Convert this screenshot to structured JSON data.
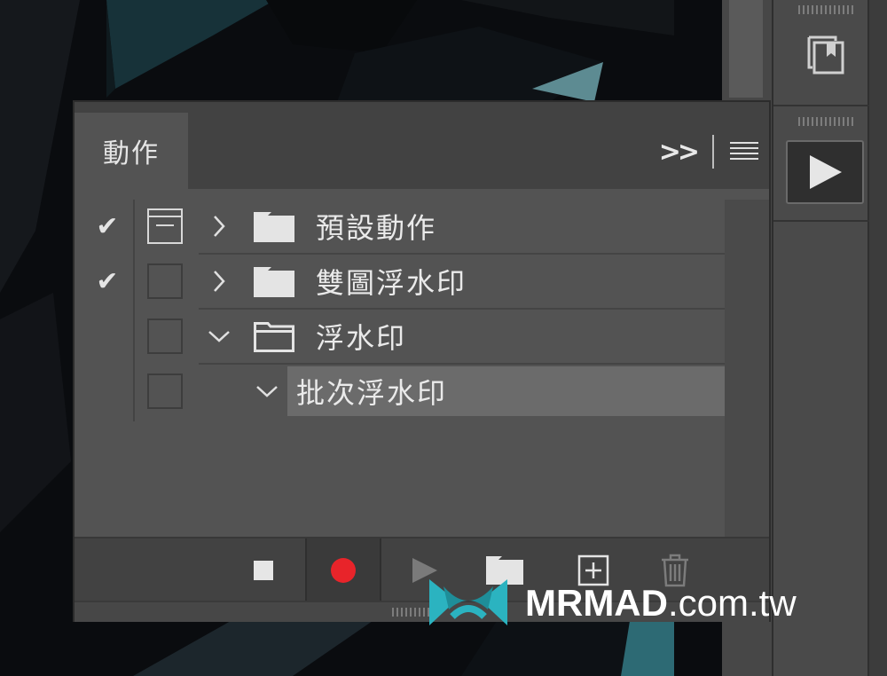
{
  "panel": {
    "tab_label": "動作",
    "menu_icon": "hamburger-icon",
    "expand_icon": "double-chevron-right-icon"
  },
  "actions": [
    {
      "name": "預設動作",
      "included": true,
      "dialog_toggle": "on",
      "expanded": false,
      "type": "set",
      "selected": false
    },
    {
      "name": "雙圖浮水印",
      "included": true,
      "dialog_toggle": "off",
      "expanded": false,
      "type": "set",
      "selected": false
    },
    {
      "name": "浮水印",
      "included": false,
      "dialog_toggle": "off",
      "expanded": true,
      "type": "set",
      "selected": false
    },
    {
      "name": "批次浮水印",
      "included": false,
      "dialog_toggle": "off",
      "expanded": true,
      "type": "action",
      "selected": true
    }
  ],
  "toolbar": {
    "buttons": [
      "stop-icon",
      "record-icon",
      "play-icon",
      "folder-icon",
      "new-action-icon",
      "trash-icon"
    ],
    "record_color": "#e8242a"
  },
  "watermark": {
    "brand": "MRMAD",
    "domain": ".com.tw",
    "logo_color": "#2bb3c0"
  }
}
